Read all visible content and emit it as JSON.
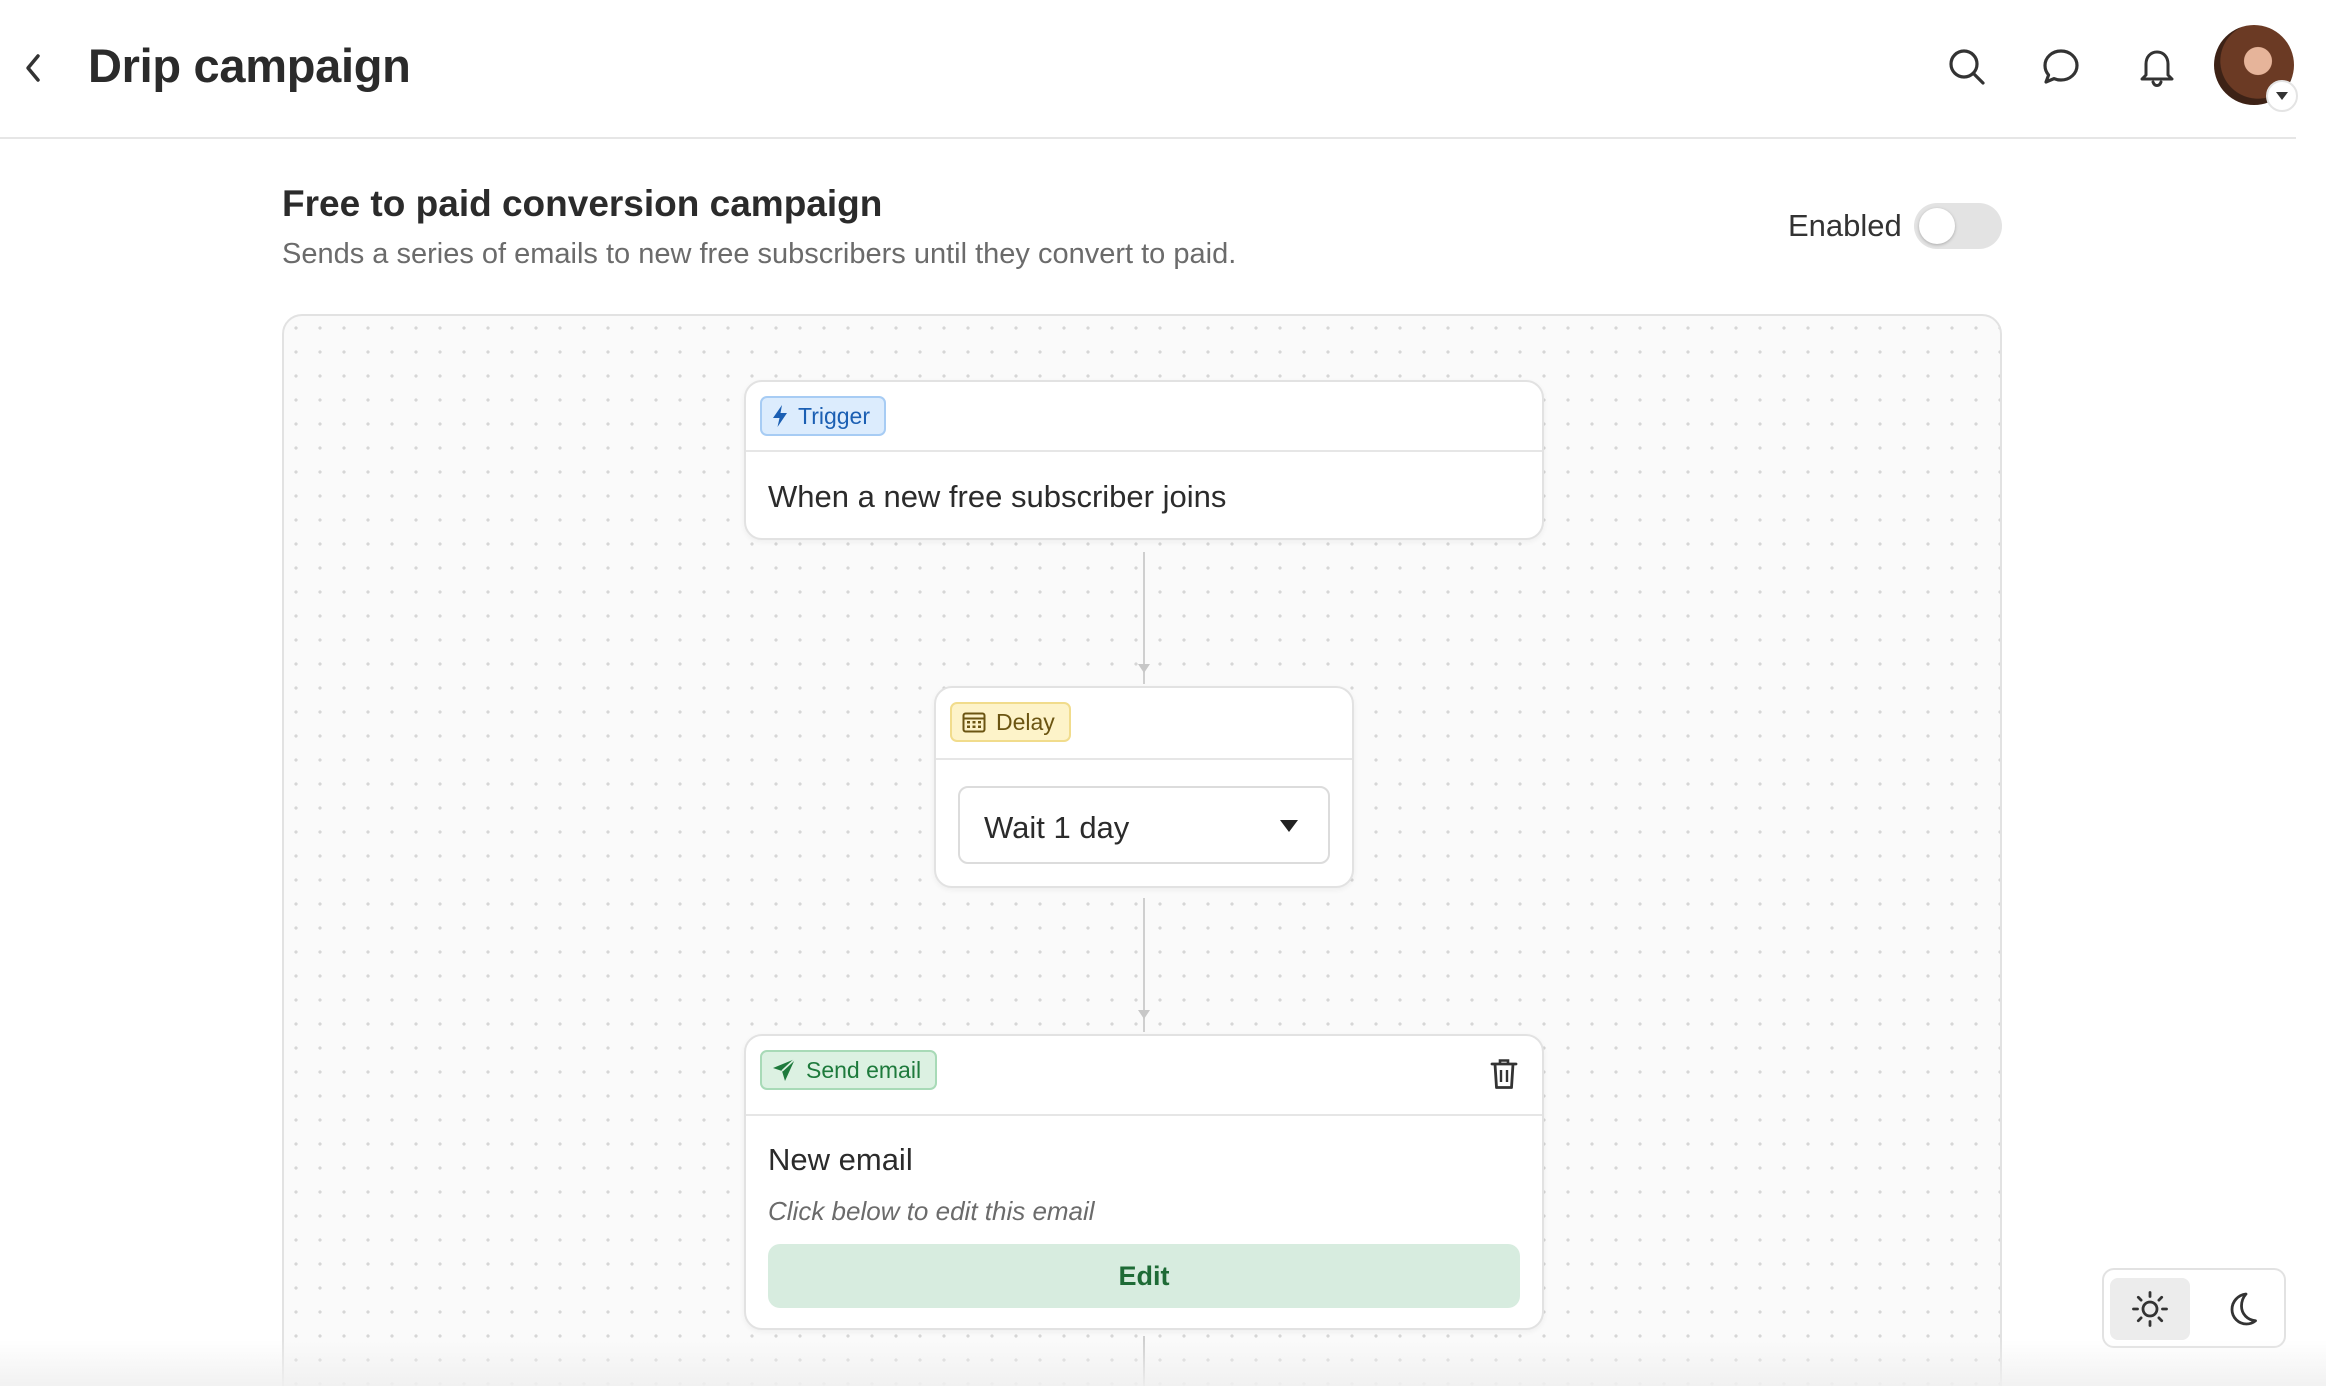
{
  "header": {
    "title": "Drip campaign",
    "icons": [
      "chevron-left-icon",
      "search-icon",
      "chat-bubble-icon",
      "bell-icon",
      "avatar",
      "caret-down-icon"
    ]
  },
  "campaign": {
    "title": "Free to paid conversion campaign",
    "description": "Sends a series of emails to new free subscribers until they convert to paid.",
    "enabled_label": "Enabled",
    "enabled": false
  },
  "flow": {
    "trigger": {
      "badge": "Trigger",
      "text": "When a new free subscriber joins"
    },
    "delay": {
      "badge": "Delay",
      "selected": "Wait 1 day"
    },
    "send_email": {
      "badge": "Send email",
      "title": "New email",
      "subtitle": "Click below to edit this email",
      "edit_label": "Edit"
    }
  },
  "theme": {
    "options": [
      "sun-icon",
      "moon-icon"
    ],
    "active": "light"
  },
  "colors": {
    "trigger_accent": "#1b5fb3",
    "delay_accent": "#6b5512",
    "send_accent": "#1e7a3c",
    "edit_button_bg": "#d7ecdf"
  }
}
